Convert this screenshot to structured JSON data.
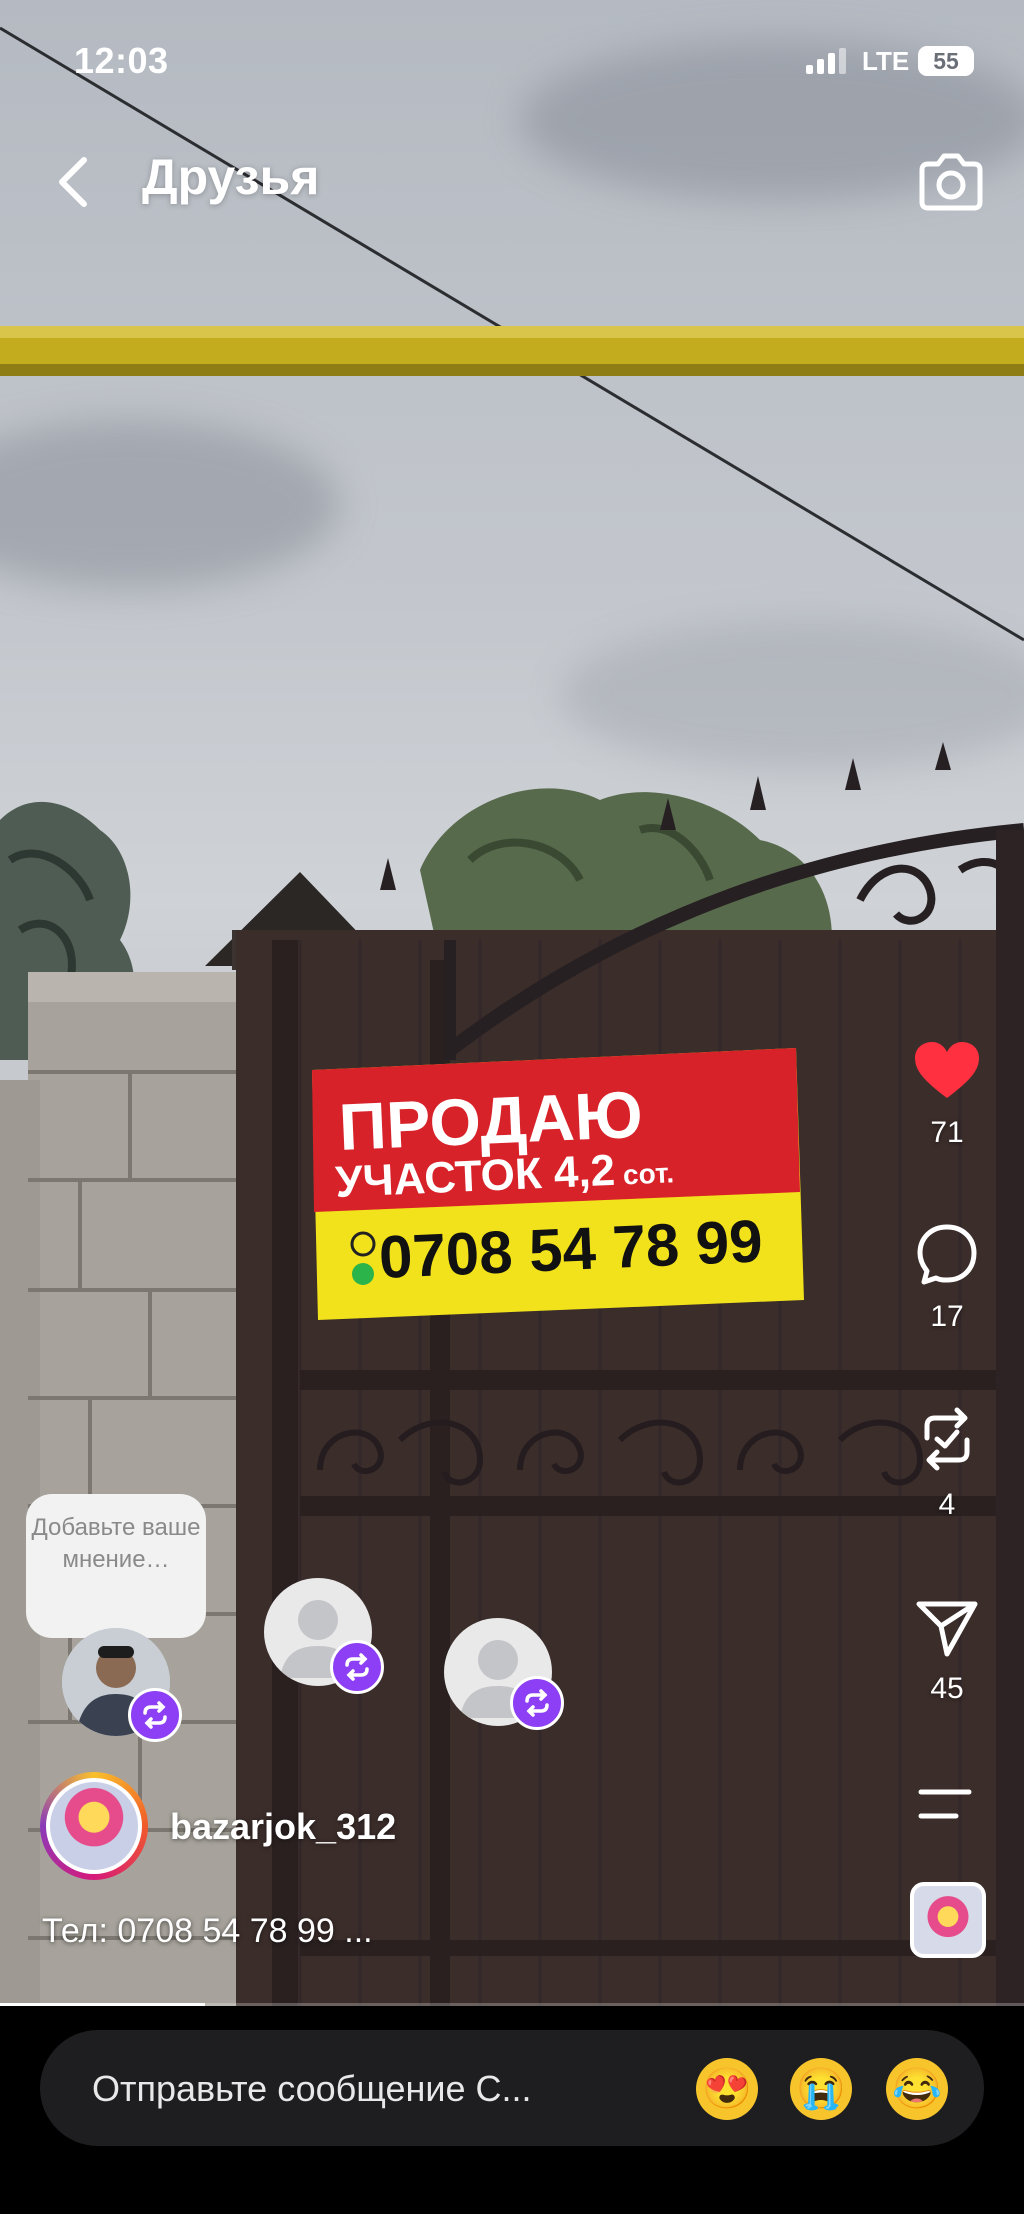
{
  "status_bar": {
    "time": "12:03",
    "network": "LTE",
    "battery": "55"
  },
  "header": {
    "title": "Друзья",
    "back_icon": "chevron-left-icon",
    "camera_icon": "camera-icon"
  },
  "sign": {
    "line1": "ПРОДАЮ",
    "line2": "УЧАСТОК 4,2",
    "line2_unit": "сот.",
    "phone": "0708 54 78 99",
    "colors": {
      "top": "#d8222a",
      "bottom": "#f2e21b"
    }
  },
  "actions": {
    "like": {
      "icon": "heart-icon",
      "count": "71",
      "color": "#ff3040"
    },
    "comment": {
      "icon": "comment-icon",
      "count": "17"
    },
    "repost": {
      "icon": "repost-icon",
      "count": "4"
    },
    "share": {
      "icon": "send-icon",
      "count": "45"
    },
    "more_icon": "menu-lines-icon",
    "audio_icon": "audio-thumbnail"
  },
  "opinion_bubble": "Добавьте ваше мнение…",
  "author": {
    "username": "bazarjok_312",
    "caption": "Тел: 0708 54 78 99 ..."
  },
  "video_progress": 0.2,
  "composer": {
    "placeholder": "Отправьте сообщение С...",
    "emojis": [
      "😍",
      "😭",
      "😂"
    ]
  }
}
